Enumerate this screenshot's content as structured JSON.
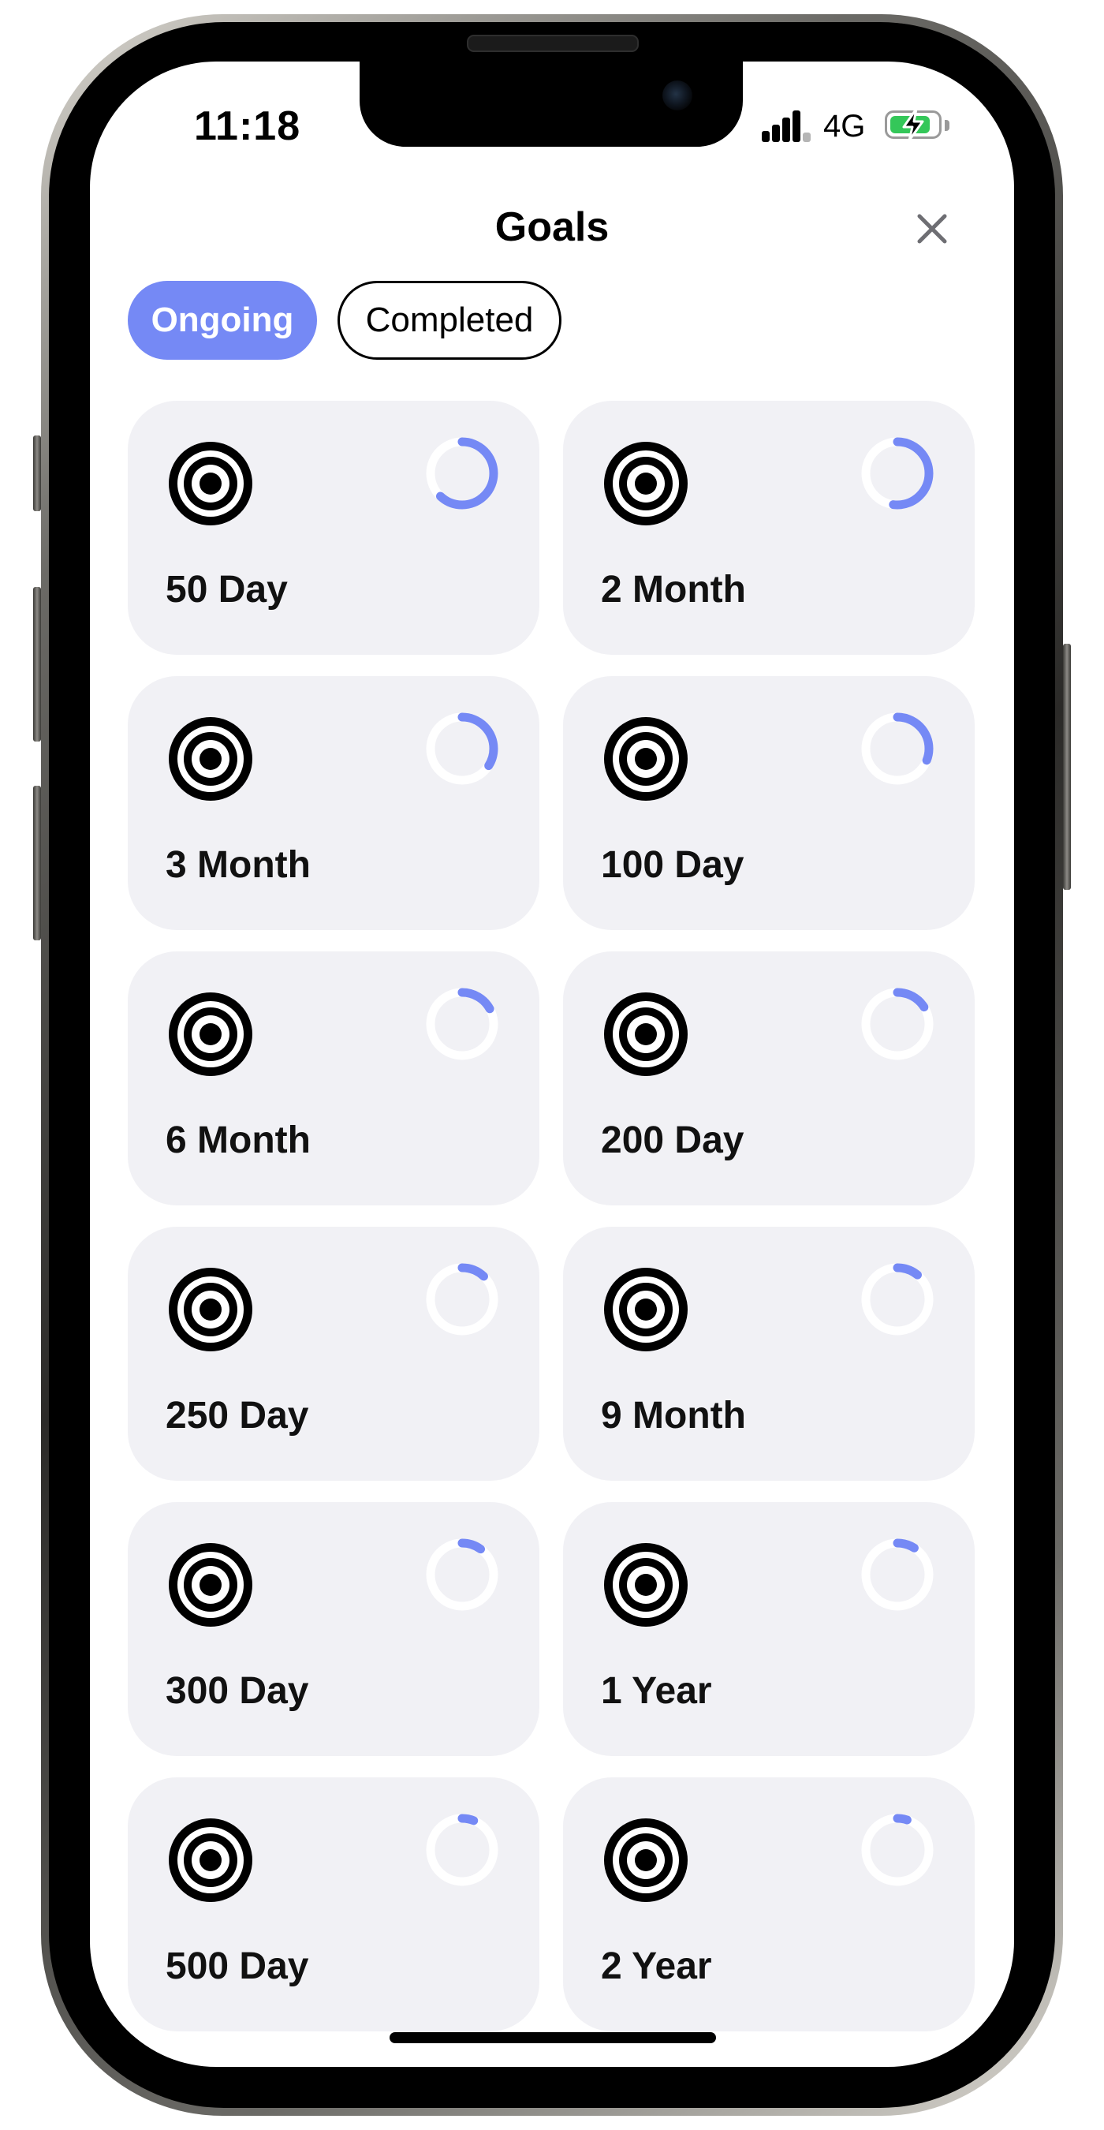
{
  "status_bar": {
    "time": "11:18",
    "network": "4G",
    "icons": [
      "signal-bars-icon",
      "battery-charging-icon"
    ],
    "battery_color": "#34c759"
  },
  "header": {
    "title": "Goals",
    "close_icon": "close-icon"
  },
  "tabs": [
    {
      "label": "Ongoing",
      "selected": true
    },
    {
      "label": "Completed",
      "selected": false
    }
  ],
  "colors": {
    "accent": "#7589f5",
    "card_bg": "#f1f1f5",
    "ring_track": "#ffffff"
  },
  "goals": [
    {
      "label": "50 Day",
      "icon": "target-icon",
      "progress": 0.62
    },
    {
      "label": "2 Month",
      "icon": "target-icon",
      "progress": 0.52
    },
    {
      "label": "3 Month",
      "icon": "target-icon",
      "progress": 0.34
    },
    {
      "label": "100 Day",
      "icon": "target-icon",
      "progress": 0.31
    },
    {
      "label": "6 Month",
      "icon": "target-icon",
      "progress": 0.17
    },
    {
      "label": "200 Day",
      "icon": "target-icon",
      "progress": 0.16
    },
    {
      "label": "250 Day",
      "icon": "target-icon",
      "progress": 0.12
    },
    {
      "label": "9 Month",
      "icon": "target-icon",
      "progress": 0.11
    },
    {
      "label": "300 Day",
      "icon": "target-icon",
      "progress": 0.1
    },
    {
      "label": "1 Year",
      "icon": "target-icon",
      "progress": 0.09
    },
    {
      "label": "500 Day",
      "icon": "target-icon",
      "progress": 0.06
    },
    {
      "label": "2 Year",
      "icon": "target-icon",
      "progress": 0.05
    }
  ]
}
